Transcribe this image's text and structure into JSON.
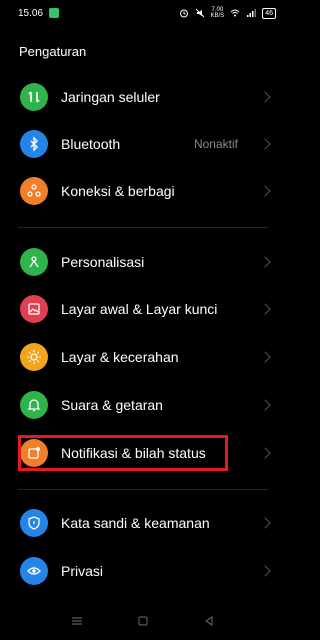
{
  "status": {
    "time": "15.06",
    "speed_value": "7.00",
    "speed_unit": "KB/S",
    "battery": "46"
  },
  "title": "Pengaturan",
  "groups": [
    {
      "items": [
        {
          "label": "Jaringan seluler",
          "icon": "mobile-network-icon",
          "color": "#2fb34a"
        },
        {
          "label": "Bluetooth",
          "icon": "bluetooth-icon",
          "color": "#2684e8",
          "value": "Nonaktif"
        },
        {
          "label": "Koneksi & berbagi",
          "icon": "share-icon",
          "color": "#f07f2a"
        }
      ]
    },
    {
      "items": [
        {
          "label": "Personalisasi",
          "icon": "personalize-icon",
          "color": "#2fb34a"
        },
        {
          "label": "Layar awal & Layar kunci",
          "icon": "image-icon",
          "color": "#e0404f"
        },
        {
          "label": "Layar & kecerahan",
          "icon": "brightness-icon",
          "color": "#f2a51c"
        },
        {
          "label": "Suara & getaran",
          "icon": "bell-icon",
          "color": "#2fb34a"
        },
        {
          "label": "Notifikasi & bilah status",
          "icon": "notification-icon",
          "color": "#f07f2a"
        }
      ]
    },
    {
      "items": [
        {
          "label": "Kata sandi & keamanan",
          "icon": "shield-icon",
          "color": "#2684e8"
        },
        {
          "label": "Privasi",
          "icon": "privacy-eye-icon",
          "color": "#2684e8"
        }
      ]
    }
  ],
  "highlight_color": "#e31b1b",
  "nav": {
    "menu": "menu-icon",
    "home": "home-icon",
    "back": "back-icon"
  }
}
